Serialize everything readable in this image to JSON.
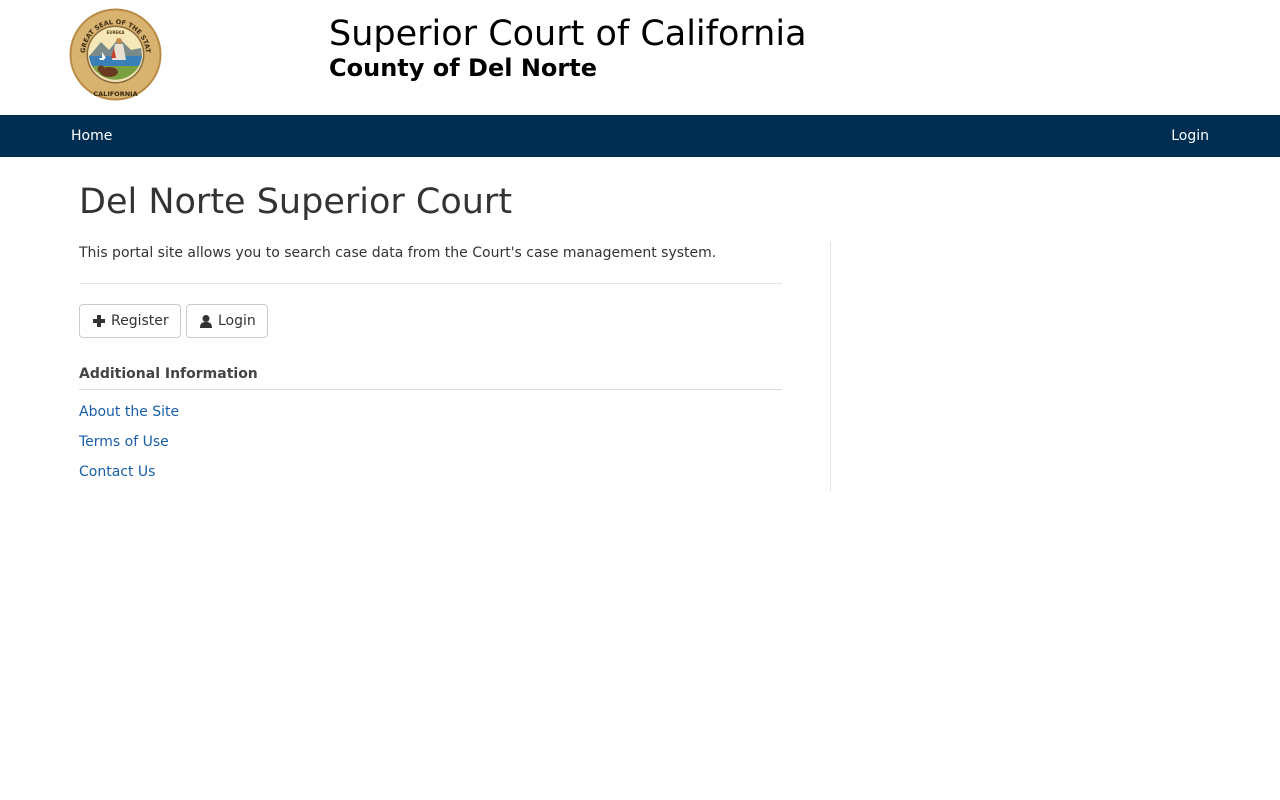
{
  "header": {
    "seal_text_top": "THE GREAT SEAL OF THE STATE OF",
    "seal_text_bottom": "CALIFORNIA",
    "seal_motto": "EUREKA",
    "title": "Superior Court of California",
    "subtitle": "County of Del Norte"
  },
  "nav": {
    "home_label": "Home",
    "login_label": "Login"
  },
  "main": {
    "title": "Del Norte Superior Court",
    "intro": "This portal site allows you to search case data from the Court's case management system.",
    "buttons": {
      "register_label": "Register",
      "register_icon": "plus-icon",
      "login_label": "Login",
      "login_icon": "user-icon"
    },
    "additional_info": {
      "heading": "Additional Information",
      "links": [
        {
          "label": "About the Site"
        },
        {
          "label": "Terms of Use"
        },
        {
          "label": "Contact Us"
        }
      ]
    }
  },
  "colors": {
    "nav_background": "#002e52",
    "link": "#1a5ea8",
    "seal_gold": "#c9a25a"
  }
}
